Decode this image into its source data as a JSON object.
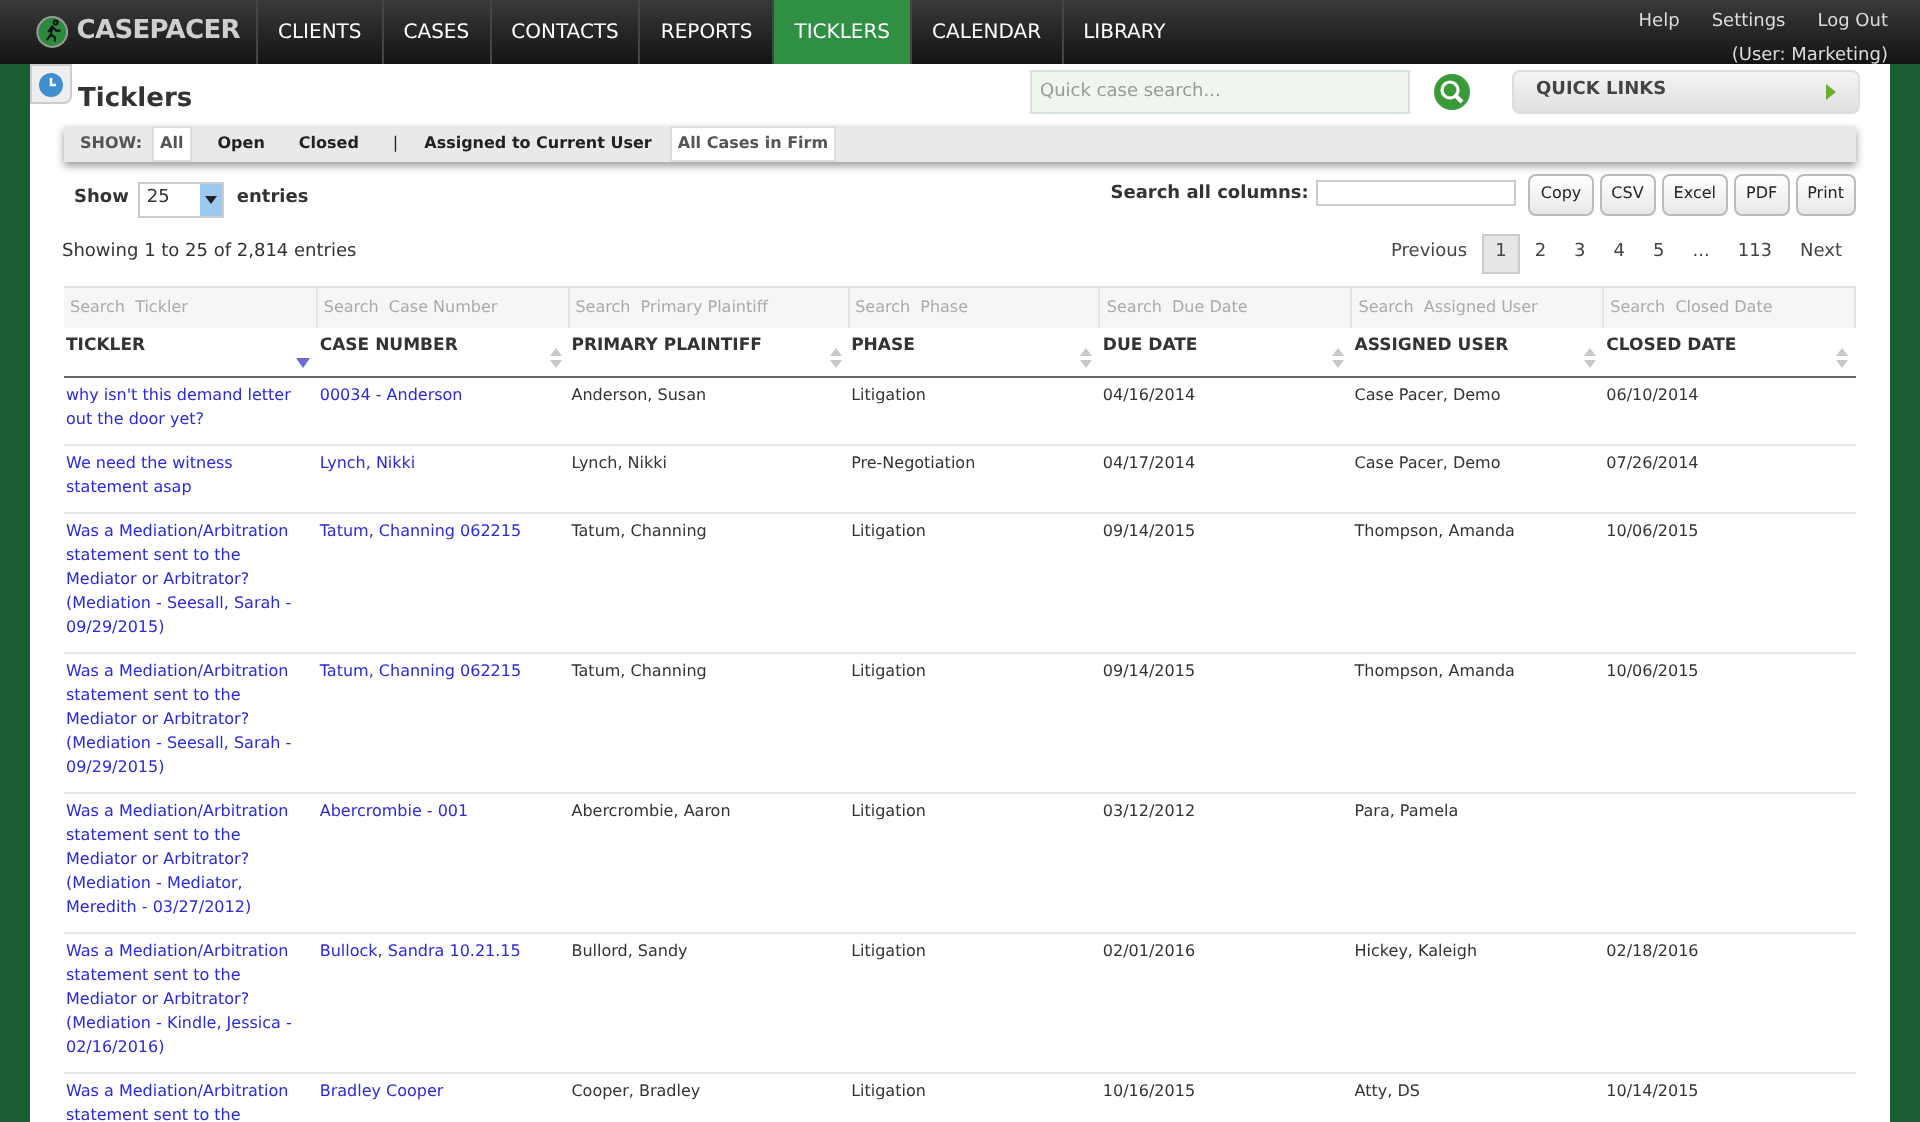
{
  "nav": {
    "logo": "CASEPACER",
    "items": [
      {
        "label": "CLIENTS",
        "selected": false
      },
      {
        "label": "CASES",
        "selected": false
      },
      {
        "label": "CONTACTS",
        "selected": false
      },
      {
        "label": "REPORTS",
        "selected": false
      },
      {
        "label": "TICKLERS",
        "selected": true
      },
      {
        "label": "CALENDAR",
        "selected": false
      },
      {
        "label": "LIBRARY",
        "selected": false
      }
    ],
    "links": [
      "Help",
      "Settings",
      "Log Out"
    ],
    "user": "(User: Marketing)"
  },
  "page": {
    "title": "Ticklers",
    "quick_search": {
      "placeholder": "Quick case search..."
    },
    "quick_links": "QUICK LINKS"
  },
  "show_filter": {
    "label": "SHOW:",
    "status": [
      {
        "label": "All",
        "selected": true
      },
      {
        "label": "Open",
        "selected": false
      },
      {
        "label": "Closed",
        "selected": false
      }
    ],
    "separator": "|",
    "scope": [
      {
        "label": "Assigned to Current User",
        "selected": false
      },
      {
        "label": "All Cases in Firm",
        "selected": true
      }
    ]
  },
  "table_controls": {
    "show_label": "Show",
    "page_size": "25",
    "entries_label": "entries",
    "search_label": "Search all columns:",
    "export_buttons": [
      "Copy",
      "CSV",
      "Excel",
      "PDF",
      "Print"
    ],
    "info": "Showing 1 to 25 of 2,814 entries",
    "pagination": [
      {
        "label": "Previous",
        "selected": false
      },
      {
        "label": "1",
        "selected": true
      },
      {
        "label": "2",
        "selected": false
      },
      {
        "label": "3",
        "selected": false
      },
      {
        "label": "4",
        "selected": false
      },
      {
        "label": "5",
        "selected": false
      },
      {
        "label": "...",
        "selected": false
      },
      {
        "label": "113",
        "selected": false
      },
      {
        "label": "Next",
        "selected": false
      }
    ]
  },
  "table": {
    "columns": [
      {
        "label": "TICKLER",
        "filter_placeholder": "Search  Tickler",
        "sorted": true
      },
      {
        "label": "CASE NUMBER",
        "filter_placeholder": "Search  Case Number",
        "sorted": false
      },
      {
        "label": "PRIMARY PLAINTIFF",
        "filter_placeholder": "Search  Primary Plaintiff",
        "sorted": false
      },
      {
        "label": "PHASE",
        "filter_placeholder": "Search  Phase",
        "sorted": false
      },
      {
        "label": "DUE DATE",
        "filter_placeholder": "Search  Due Date",
        "sorted": false
      },
      {
        "label": "ASSIGNED USER",
        "filter_placeholder": "Search  Assigned User",
        "sorted": false
      },
      {
        "label": "CLOSED DATE",
        "filter_placeholder": "Search  Closed Date",
        "sorted": false
      }
    ],
    "rows": [
      [
        "why isn't this demand letter out the door yet?",
        "00034 - Anderson",
        "Anderson, Susan",
        "Litigation",
        "04/16/2014",
        "Case Pacer, Demo",
        "06/10/2014"
      ],
      [
        "We need the witness statement asap",
        "Lynch, Nikki",
        "Lynch, Nikki",
        "Pre-Negotiation",
        "04/17/2014",
        "Case Pacer, Demo",
        "07/26/2014"
      ],
      [
        "Was a Mediation/Arbitration statement sent to the Mediator or Arbitrator? (Mediation - Seesall, Sarah - 09/29/2015)",
        "Tatum, Channing 062215",
        "Tatum, Channing",
        "Litigation",
        "09/14/2015",
        "Thompson, Amanda",
        "10/06/2015"
      ],
      [
        "Was a Mediation/Arbitration statement sent to the Mediator or Arbitrator? (Mediation - Seesall, Sarah - 09/29/2015)",
        "Tatum, Channing 062215",
        "Tatum, Channing",
        "Litigation",
        "09/14/2015",
        "Thompson, Amanda",
        "10/06/2015"
      ],
      [
        "Was a Mediation/Arbitration statement sent to the Mediator or Arbitrator? (Mediation - Mediator, Meredith - 03/27/2012)",
        "Abercrombie - 001",
        "Abercrombie, Aaron",
        "Litigation",
        "03/12/2012",
        "Para, Pamela",
        ""
      ],
      [
        "Was a Mediation/Arbitration statement sent to the Mediator or Arbitrator? (Mediation - Kindle, Jessica - 02/16/2016)",
        "Bullock, Sandra 10.21.15",
        "Bullord, Sandy",
        "Litigation",
        "02/01/2016",
        "Hickey, Kaleigh",
        "02/18/2016"
      ],
      [
        "Was a Mediation/Arbitration statement sent to the",
        "Bradley Cooper",
        "Cooper, Bradley",
        "Litigation",
        "10/16/2015",
        "Atty, DS",
        "10/14/2015"
      ]
    ]
  }
}
